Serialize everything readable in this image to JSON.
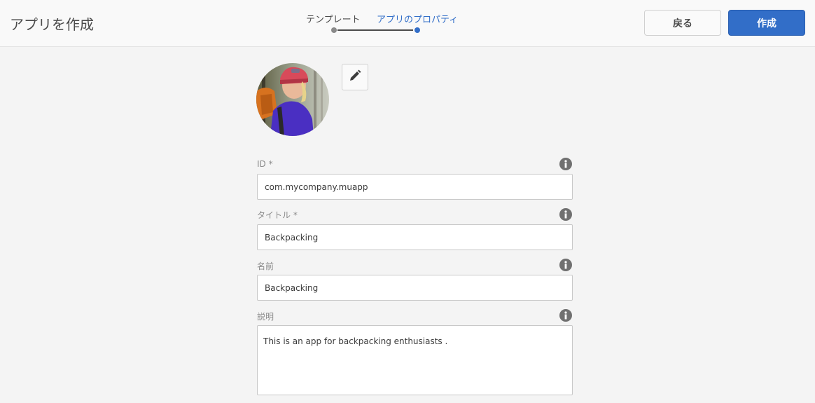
{
  "header": {
    "title": "アプリを作成",
    "steps": [
      {
        "label": "テンプレート",
        "state": "done"
      },
      {
        "label": "アプリのプロパティ",
        "state": "current"
      }
    ],
    "back_label": "戻る",
    "create_label": "作成"
  },
  "colors": {
    "accent": "#326ec8",
    "background": "#f4f4f4",
    "header_bg": "#f9f9f9"
  },
  "thumbnail": {
    "icon": "edit-pencil-icon"
  },
  "form": {
    "id": {
      "label": "ID *",
      "value": "com.mycompany.muapp"
    },
    "title": {
      "label": "タイトル *",
      "value": "Backpacking"
    },
    "name": {
      "label": "名前",
      "value": "Backpacking"
    },
    "description": {
      "label": "説明",
      "value": "This is an app for backpacking enthusiasts ."
    }
  }
}
